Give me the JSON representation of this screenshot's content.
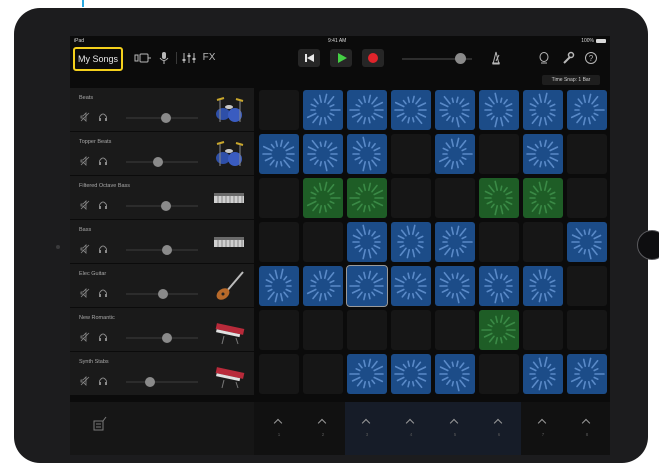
{
  "status_bar": {
    "device": "iPad",
    "time": "9:41 AM",
    "battery": "100%"
  },
  "toolbar": {
    "my_songs_label": "My Songs",
    "fx_label": "FX",
    "time_snap": "Time Snap: 1 Bar"
  },
  "tracks": [
    {
      "name": "Beats",
      "volume": 0.55,
      "instrument": "drum-kit-icon"
    },
    {
      "name": "Topper Beats",
      "volume": 0.45,
      "instrument": "drum-kit-icon"
    },
    {
      "name": "Filtered Octave Bass",
      "volume": 0.55,
      "instrument": "keyboard-icon"
    },
    {
      "name": "Bass",
      "volume": 0.57,
      "instrument": "keyboard-icon"
    },
    {
      "name": "Elec Guitar",
      "volume": 0.52,
      "instrument": "guitar-icon"
    },
    {
      "name": "New Romantic",
      "volume": 0.57,
      "instrument": "synth-icon"
    },
    {
      "name": "Synth Stabs",
      "volume": 0.33,
      "instrument": "synth-icon"
    }
  ],
  "grid": [
    [
      null,
      "blue",
      "blue",
      "blue",
      "blue",
      "blue",
      "blue",
      "blue"
    ],
    [
      "blue",
      "blue",
      "blue",
      null,
      "blue",
      null,
      "blue",
      null
    ],
    [
      null,
      "green",
      "green",
      null,
      null,
      "green",
      "green",
      null
    ],
    [
      null,
      null,
      "blue",
      "blue",
      "blue",
      null,
      null,
      "blue"
    ],
    [
      "blue",
      "blue",
      "blue",
      "blue",
      "blue",
      "blue",
      "blue",
      null
    ],
    [
      null,
      null,
      null,
      null,
      null,
      "green",
      null,
      null
    ],
    [
      null,
      null,
      "blue",
      "blue",
      "blue",
      null,
      "blue",
      "blue"
    ]
  ],
  "column_triggers": [
    "1",
    "2",
    "3",
    "4",
    "5",
    "6",
    "7",
    "8"
  ],
  "colors": {
    "accent_yellow": "#f4d01c",
    "cell_blue": "#1c4c88",
    "cell_green": "#1e5d26",
    "play_green": "#44d044",
    "record_red": "#e0242b"
  }
}
